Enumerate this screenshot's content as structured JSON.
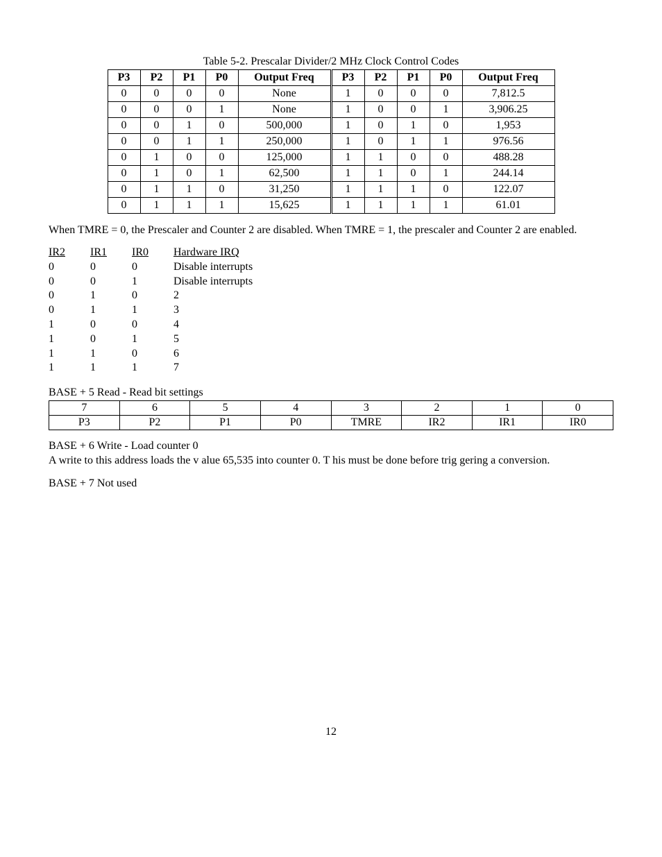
{
  "caption1": "Table 5-2. Prescalar Divider/2 MHz Clock Control Codes",
  "t1_headers": [
    "P3",
    "P2",
    "P1",
    "P0",
    "Output Freq",
    "P3",
    "P2",
    "P1",
    "P0",
    "Output Freq"
  ],
  "t1_rows": [
    [
      "0",
      "0",
      "0",
      "0",
      "None",
      "1",
      "0",
      "0",
      "0",
      "7,812.5"
    ],
    [
      "0",
      "0",
      "0",
      "1",
      "None",
      "1",
      "0",
      "0",
      "1",
      "3,906.25"
    ],
    [
      "0",
      "0",
      "1",
      "0",
      "500,000",
      "1",
      "0",
      "1",
      "0",
      "1,953"
    ],
    [
      "0",
      "0",
      "1",
      "1",
      "250,000",
      "1",
      "0",
      "1",
      "1",
      "976.56"
    ],
    [
      "0",
      "1",
      "0",
      "0",
      "125,000",
      "1",
      "1",
      "0",
      "0",
      "488.28"
    ],
    [
      "0",
      "1",
      "0",
      "1",
      "62,500",
      "1",
      "1",
      "0",
      "1",
      "244.14"
    ],
    [
      "0",
      "1",
      "1",
      "0",
      "31,250",
      "1",
      "1",
      "1",
      "0",
      "122.07"
    ],
    [
      "0",
      "1",
      "1",
      "1",
      "15,625",
      "1",
      "1",
      "1",
      "1",
      "61.01"
    ]
  ],
  "para1": "When TMRE = 0, the Prescaler and Counter 2 are  disabled.  When TMRE = 1, the prescaler and Counter 2 are enabled.",
  "irq_headers": [
    "IR2",
    "IR1",
    "IR0",
    "Hardware IRQ"
  ],
  "irq_rows": [
    [
      "0",
      "0",
      "0",
      "Disable interrupts"
    ],
    [
      "0",
      "0",
      "1",
      "Disable interrupts"
    ],
    [
      "0",
      "1",
      "0",
      "2"
    ],
    [
      "0",
      "1",
      "1",
      "3"
    ],
    [
      "1",
      "0",
      "0",
      "4"
    ],
    [
      "1",
      "0",
      "1",
      "5"
    ],
    [
      "1",
      "1",
      "0",
      "6"
    ],
    [
      "1",
      "1",
      "1",
      "7"
    ]
  ],
  "base5_label": "BASE + 5    Read  -  Read bit settings",
  "t2_row1": [
    "7",
    "6",
    "5",
    "4",
    "3",
    "2",
    "1",
    "0"
  ],
  "t2_row2": [
    "P3",
    "P2",
    "P1",
    "P0",
    "TMRE",
    "IR2",
    "IR1",
    "IR0"
  ],
  "base6_label": "BASE + 6   Write - Load counter 0",
  "base6_text": "A write to this address   loads  the v alue  65,535 into counter 0.  T   his must  be  done before trig gering a conversion.",
  "base7_label": "BASE + 7   Not used",
  "page_number": "12"
}
